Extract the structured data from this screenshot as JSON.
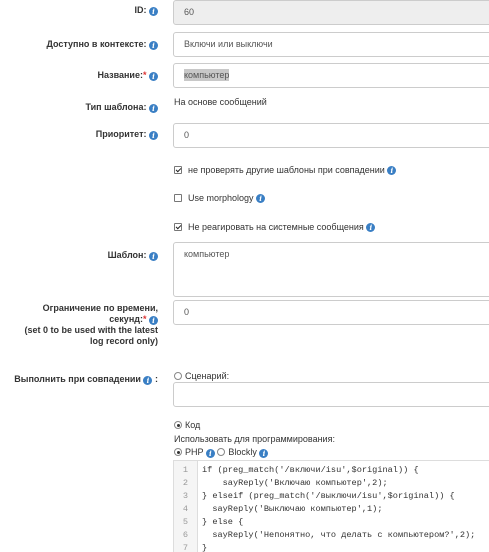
{
  "form": {
    "id": {
      "label": "ID:",
      "value": "60"
    },
    "context": {
      "label": "Доступно в контексте:",
      "value": "Включи или выключи"
    },
    "name": {
      "label": "Название:",
      "required": "*",
      "value": "компьютер"
    },
    "type": {
      "label": "Тип шаблона:",
      "value": "На основе сообщений"
    },
    "priority": {
      "label": "Приоритет:",
      "value": "0"
    },
    "checkboxes": [
      {
        "label": "не проверять другие шаблоны при совпадении",
        "checked": true
      },
      {
        "label": "Use morphology",
        "checked": false
      },
      {
        "label": "Не реагировать на системные сообщения",
        "checked": true
      }
    ],
    "template": {
      "label": "Шаблон:",
      "value": "компьютер"
    },
    "timeout": {
      "label_line1": "Ограничение по времени,",
      "label_line2": "секунд:",
      "required": "*",
      "note_line1": "(set 0 to be used with the latest",
      "note_line2": "log record only)",
      "value": "0"
    },
    "on_match": {
      "label": "Выполнить при совпадении",
      "colon": ":",
      "scenario_label": "Сценарий:",
      "code_label": "Код",
      "use_for_programming": "Использовать для программирования:",
      "php_label": "PHP",
      "blockly_label": "Blockly"
    },
    "code_lines": [
      {
        "n": "1",
        "text": "if (preg_match('/включи/isu',$original)) {"
      },
      {
        "n": "2",
        "text": "    sayReply('Включаю компьютер',2);"
      },
      {
        "n": "3",
        "text": "} elseif (preg_match('/выключи/isu',$original)) {"
      },
      {
        "n": "4",
        "text": "  sayReply('Выключаю компьютер',1);"
      },
      {
        "n": "5",
        "text": "} else {"
      },
      {
        "n": "6",
        "text": "  sayReply('Непонятно, что делать с компьютером?',2);"
      },
      {
        "n": "7",
        "text": "}"
      }
    ]
  },
  "colors": {
    "info": "#3a7fc4",
    "required": "#d33"
  },
  "icons": {
    "info": "info-icon"
  }
}
